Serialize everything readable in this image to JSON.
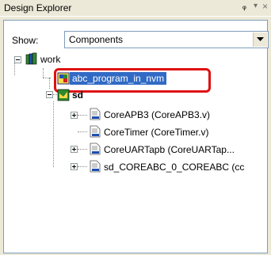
{
  "window": {
    "title": "Design Explorer",
    "pin_glyph": "ᵩ",
    "menu_glyph": "▾",
    "close_glyph": "×"
  },
  "show": {
    "label": "Show:",
    "value": "Components"
  },
  "tree": {
    "root": {
      "label": "work",
      "icon": "library-books-icon"
    },
    "selected_item": {
      "label": "abc_program_in_nvm",
      "icon": "program-icon"
    },
    "design": {
      "label": "sd",
      "icon": "smartdesign-icon"
    },
    "components": [
      {
        "label": "CoreAPB3 (CoreAPB3.v)",
        "icon": "hdl-file-icon"
      },
      {
        "label": "CoreTimer (CoreTimer.v)",
        "icon": "hdl-file-icon"
      },
      {
        "label": "CoreUARTapb (CoreUARTap...",
        "icon": "hdl-file-icon"
      },
      {
        "label": "sd_COREABC_0_COREABC (cc",
        "icon": "hdl-file-icon"
      }
    ]
  },
  "colors": {
    "selection": "#316ac5",
    "highlight_outline": "#e01010"
  }
}
